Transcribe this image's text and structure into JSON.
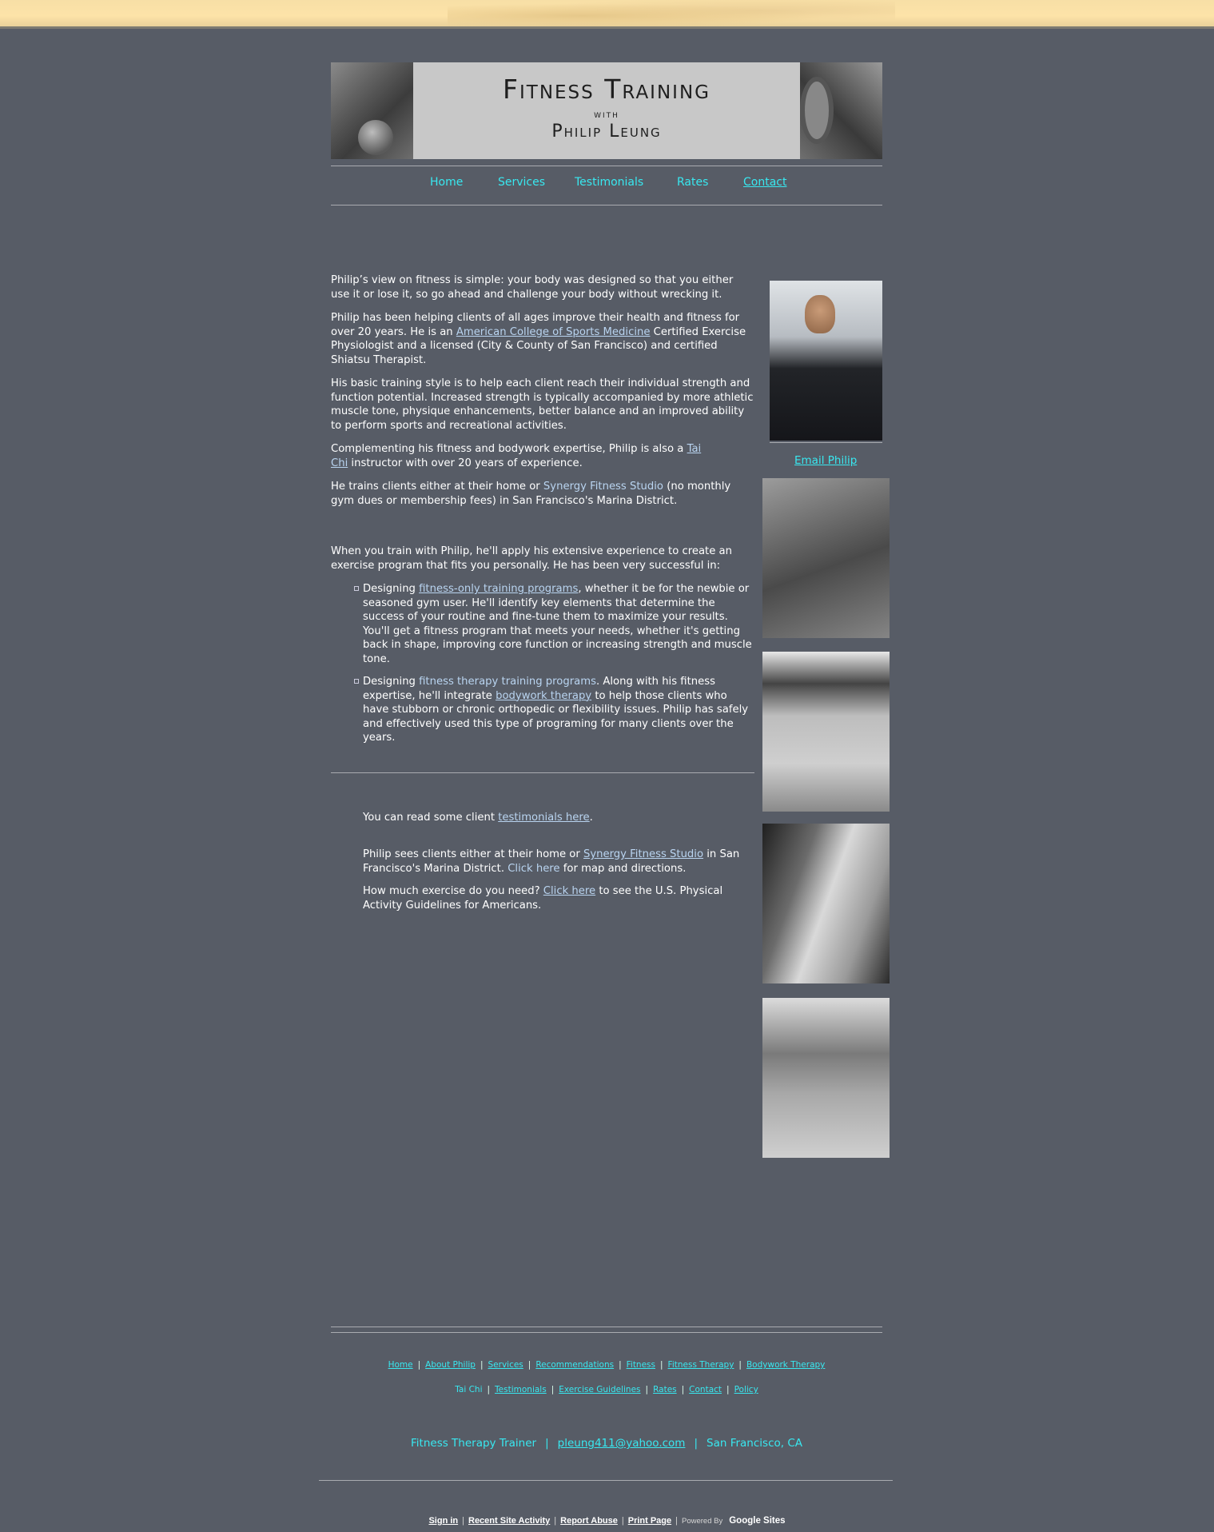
{
  "banner": {
    "line1": "Fitness Training",
    "line2": "with",
    "line3": "Philip Leung"
  },
  "nav": {
    "items": [
      {
        "label": "Home"
      },
      {
        "label": "Services"
      },
      {
        "label": "Testimonials"
      },
      {
        "label": "Rates"
      },
      {
        "label": "Contact"
      }
    ]
  },
  "main": {
    "p1": "Philip’s view on fitness is simple:  your body was designed so that you either use it or lose it, so go ahead and challenge your body without wrecking it.",
    "p2_a": "Philip has been helping clients of all ages improve their health and fitness for over 20 years.  He is an ",
    "p2_link": "American College of Sports Medicine",
    "p2_b": " Certified Exercise Physiologist and a licensed (City & County of San Francisco) and certified Shiatsu Therapist.",
    "p3": "His basic training style is to help each client reach their individual strength and function potential.  Increased strength is typically accompanied by more athletic muscle tone, physique enhancements, better balance and an improved ability to perform sports and recreational activities.",
    "p4_a": "Complementing his fitness and bodywork expertise, Philip is also a ",
    "p4_link": "Tai Chi",
    "p4_b": " instructor with over 20 years of experience.",
    "p5_a": "He trains clients either at their home or ",
    "p5_link": "Synergy Fitness Studio",
    "p5_b": " (no monthly gym dues or membership fees) in San Francisco's Marina District.",
    "p6": "When you train with Philip, he'll apply his extensive experience to create an exercise program that fits you personally.  He has been very successful in:",
    "b1_a": "Designing ",
    "b1_link": "fitness-only training programs",
    "b1_b": ", whether it be for the newbie or seasoned gym user.  He'll identify key elements that determine the success of your routine and fine-tune them to maximize your results.  You'll get a fitness program that meets your needs, whether it's getting back in shape, improving core function or increasing strength and muscle tone.",
    "b2_a": "Designing ",
    "b2_link": "fitness therapy training programs",
    "b2_b": ".  Along with his fitness expertise, he'll integrate ",
    "b2_link2": "bodywork therapy",
    "b2_c": " to help those clients who have stubborn or chronic orthopedic or flexibility issues.  Philip has safely and effectively used this type of programing for many clients over the years.",
    "q1_a": "You can read some client ",
    "q1_link": "testimonials here",
    "q1_b": ".",
    "q2_a": "Philip sees clients either at their home or ",
    "q2_link": "Synergy Fitness Studio",
    "q2_b": " in San Francisco's Marina District.  ",
    "q2_link2": "Click here",
    "q2_c": " for map and directions.",
    "q3_a": "How much exercise do you need?  ",
    "q3_link": "Click here",
    "q3_b": " to see the U.S. Physical Activity Guidelines for Americans."
  },
  "sidebar": {
    "email_label": "Email Philip"
  },
  "footer": {
    "row1": [
      "Home",
      "About Philip",
      "Services",
      "Recommendations",
      "Fitness",
      "Fitness Therapy",
      "Bodywork Therapy"
    ],
    "row2": [
      "Tai Chi",
      "Testimonials",
      "Exercise Guidelines",
      "Rates",
      "Contact",
      "Policy"
    ],
    "contact_title": "Fitness Therapy Trainer",
    "email": "pleung411@yahoo.com",
    "city": "San Francisco, CA"
  },
  "google_bar": {
    "sign_in": "Sign in",
    "recent": "Recent Site Activity",
    "report": "Report Abuse",
    "print": "Print Page",
    "powered": "Powered By",
    "brand": "Google Sites"
  }
}
